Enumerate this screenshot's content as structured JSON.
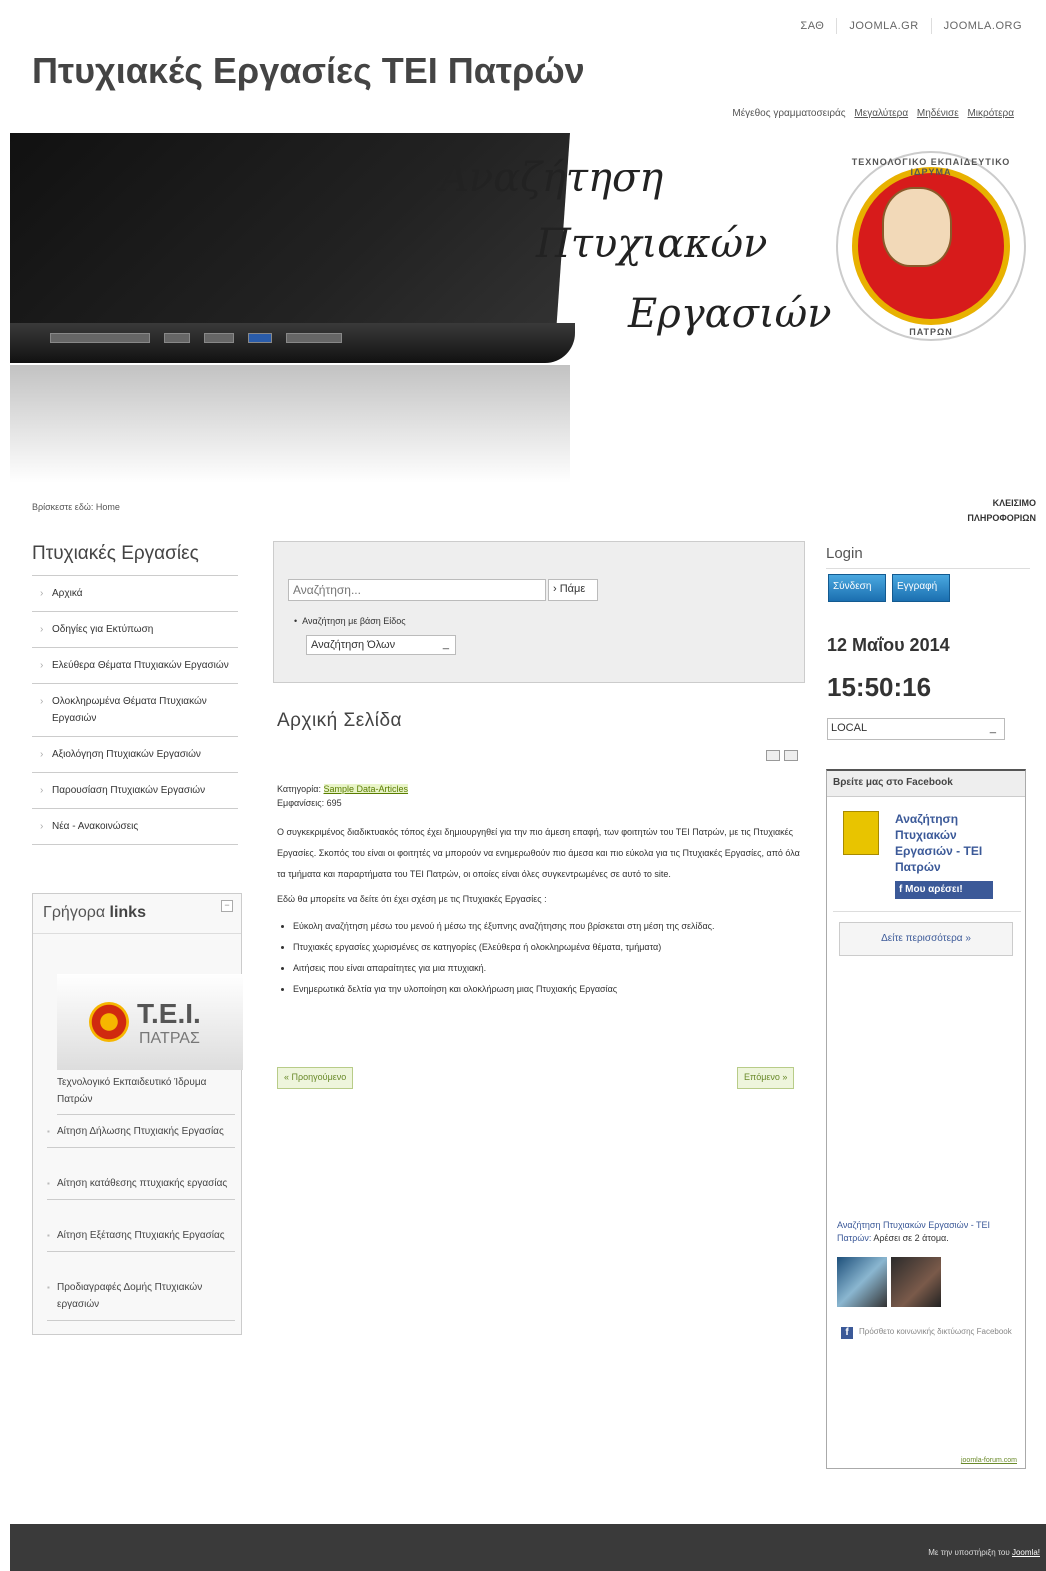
{
  "top_nav": [
    "ΣΑΘ",
    "JOOMLA.GR",
    "JOOMLA.ORG"
  ],
  "site_title": "Πτυχιακές Εργασίες ΤΕΙ Πατρών",
  "font_size": {
    "label": "Μέγεθος γραμματοσειράς",
    "bigger": "Μεγαλύτερα",
    "reset": "Μηδένισε",
    "smaller": "Μικρότερα"
  },
  "banner": {
    "line1": "Αναζήτηση",
    "line2": "Πτυχιακών",
    "line3": "Εργασιών",
    "seal_top": "ΤΕΧΝΟΛΟΓΙΚΟ ΕΚΠΑΙΔΕΥΤΙΚΟ ΙΔΡΥΜΑ",
    "seal_bottom": "ΠΑΤΡΩΝ"
  },
  "breadcrumb": "Βρίσκεστε εδώ: Home",
  "info_center": [
    "ΚΛΕΙΣΙΜΟ",
    "ΠΛΗΡΟΦΟΡΙΩΝ"
  ],
  "left_menu": {
    "title": "Πτυχιακές Εργασίες",
    "items": [
      "Αρχικά",
      "Οδηγίες για Εκτύπωση",
      "Ελεύθερα Θέματα Πτυχιακών Εργασιών",
      "Ολοκληρωμένα Θέματα Πτυχιακών Εργασιών",
      "Αξιολόγηση Πτυχιακών Εργασιών",
      "Παρουσίαση Πτυχιακών Εργασιών",
      "Νέα - Ανακοινώσεις"
    ]
  },
  "quick_links": {
    "title_normal": "Γρήγορα ",
    "title_bold": "links",
    "collapse": "−",
    "logo_text": "T.E.I.",
    "logo_sub": "ΠΑΤΡΑΣ",
    "logo_caption": "Τεχνολογικό Εκπαιδευτικό Ίδρυμα Πατρών",
    "items": [
      "Αίτηση Δήλωσης Πτυχιακής Εργασίας",
      "Αίτηση κατάθεσης πτυχιακής εργασίας",
      "Αίτηση Εξέτασης Πτυχιακής Εργασίας",
      "Προδιαγραφές Δομής Πτυχιακών εργασιών"
    ]
  },
  "search": {
    "placeholder": "Αναζήτηση...",
    "button": "› Πάμε",
    "type_label": "Αναζήτηση με βάση Είδος",
    "type_value": "Αναζήτηση Όλων"
  },
  "article": {
    "heading": "Αρχική Σελίδα",
    "category_label": "Κατηγορία: ",
    "category": "Sample Data-Articles",
    "views": "Εμφανίσεις: 695",
    "p1": "Ο συγκεκριμένος διαδικτυακός τόπος έχει δημιουργηθεί για την πιο άμεση επαφή, των φοιτητών του ΤΕΙ Πατρών, με τις Πτυχιακές Εργασίες. Σκοπός του είναι οι φοιτητές να μπορούν να ενημερωθούν πιο άμεσα και πιο εύκολα για τις Πτυχιακές Εργασίες, από όλα τα τμήματα και παραρτήματα του ΤΕΙ Πατρών, οι οποίες είναι όλες συγκεντρωμένες σε αυτό το site.",
    "p2": "Εδώ θα μπορείτε να δείτε ότι έχει σχέση με τις Πτυχιακές Εργασίες :",
    "bullets": [
      "Εύκολη αναζήτηση μέσω του μενού ή μέσω της έξυπνης αναζήτησης που βρίσκεται στη μέση της σελίδας.",
      "Πτυχιακές εργασίες χωρισμένες σε κατηγορίες (Ελεύθερα ή ολοκληρωμένα θέματα, τμήματα)",
      "Αιτήσεις που είναι απαραίτητες για μια πτυχιακή.",
      "Ενημερωτικά δελτία για την υλοποίηση και ολοκλήρωση μιας Πτυχιακής Εργασίας"
    ],
    "prev": "« Προηγούμενο",
    "next": "Επόμενο »"
  },
  "login": {
    "title": "Login",
    "signin": "Σύνδεση",
    "register": "Εγγραφή"
  },
  "clock": {
    "date": "12 Μαΐου 2014",
    "time": "15:50:16",
    "timezone": "LOCAL"
  },
  "facebook": {
    "header": "Βρείτε μας στο Facebook",
    "page_name": "Αναζήτηση Πτυχιακών Εργασιών - ΤΕΙ Πατρών",
    "like": "Μου αρέσει!",
    "see_more": "Δείτε περισσότερα »",
    "post_link": "Αναζήτηση Πτυχιακών Εργασιών - ΤΕΙ Πατρών:",
    "post_text": " Αρέσει σε 2 άτομα.",
    "plugin": "Πρόσθετο κοινωνικής δικτύωσης Facebook",
    "footer_link": "joomla-forum.com"
  },
  "footer": {
    "text": "Με την υποστήριξη του ",
    "link": "Joomla!"
  }
}
